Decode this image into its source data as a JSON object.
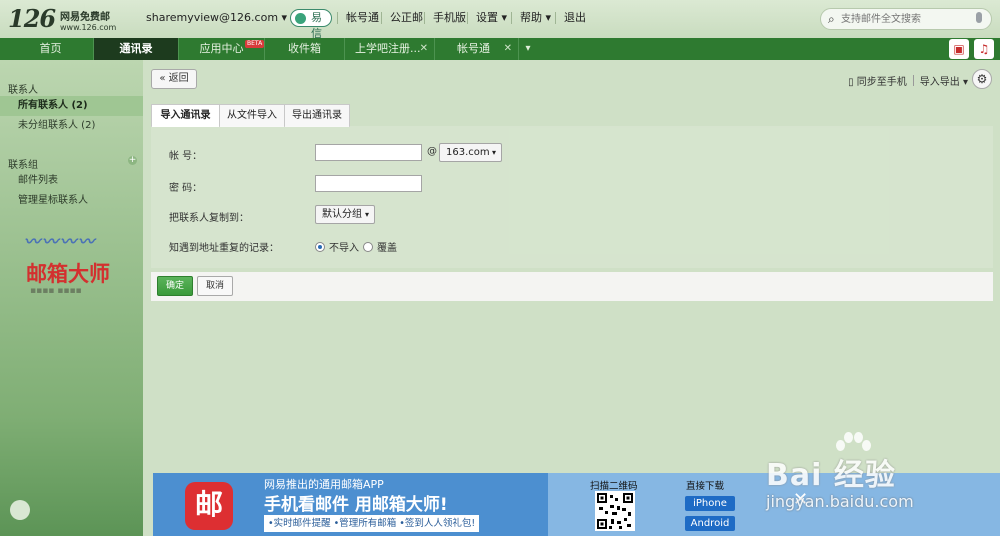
{
  "header": {
    "logo": {
      "number": "126",
      "title": "网易免费邮",
      "domain": "www.126.com"
    },
    "account": "sharemyview@126.com",
    "yixin_label": "易信",
    "links": [
      "帐号通",
      "公正邮",
      "手机版",
      "设置",
      "帮助",
      "退出"
    ],
    "search_placeholder": "支持邮件全文搜索"
  },
  "tabs": [
    {
      "label": "首页",
      "active": false,
      "closable": false
    },
    {
      "label": "通讯录",
      "active": true,
      "closable": false
    },
    {
      "label": "应用中心",
      "active": false,
      "closable": false,
      "badge": "BETA"
    },
    {
      "label": "收件箱",
      "active": false,
      "closable": false
    },
    {
      "label": "上学吧注册...",
      "active": false,
      "closable": true
    },
    {
      "label": "帐号通",
      "active": false,
      "closable": true
    }
  ],
  "sidebar": {
    "contacts_heading": "联系人",
    "items": [
      {
        "label": "所有联系人 (2)",
        "active": true
      },
      {
        "label": "未分组联系人 (2)",
        "active": false
      }
    ],
    "groups_heading": "联系组",
    "group_items": [
      {
        "label": "邮件列表"
      },
      {
        "label": "管理星标联系人"
      }
    ],
    "promo": {
      "brand": "邮箱大师"
    }
  },
  "toolbar": {
    "back_label": "返回",
    "sync_label": "同步至手机",
    "import_export_label": "导入导出"
  },
  "subtabs": [
    "导入通讯录",
    "从文件导入",
    "导出通讯录"
  ],
  "form": {
    "account_label": "帐 号：",
    "account_value": "",
    "at_symbol": "@",
    "domain_value": "163.com",
    "password_label": "密 码：",
    "password_value": "",
    "copy_to_label": "把联系人复制到：",
    "group_value": "默认分组",
    "duplicate_label": "知遇到地址重复的记录：",
    "radio_options": [
      {
        "label": "不导入",
        "checked": true
      },
      {
        "label": "覆盖",
        "checked": false
      }
    ],
    "ok_label": "确定",
    "cancel_label": "取消"
  },
  "banner": {
    "app_icon_char": "邮",
    "line1": "网易推出的通用邮箱APP",
    "line2": "手机看邮件  用邮箱大师!",
    "line3": "•实时邮件提醒 •管理所有邮箱 •签到人人领礼包!",
    "scan_label": "扫描二维码",
    "direct_label": "直接下载",
    "downloads": [
      "iPhone",
      "Android"
    ]
  },
  "watermark": {
    "big": "Bai 经验",
    "small": "jingyan.baidu.com"
  },
  "colors": {
    "tab_bar": "#2e7a30",
    "active_tab": "#1d3b1e",
    "confirm_button": "#3a9a3a",
    "banner_blue": "#4c8fd0",
    "app_icon_red": "#dd2f32"
  }
}
